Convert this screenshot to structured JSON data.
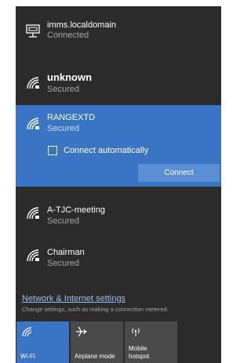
{
  "networks": [
    {
      "name": "imms.localdomain",
      "status": "Connected",
      "icon": "ethernet-icon"
    },
    {
      "name": "unknown",
      "status": "Secured",
      "icon": "wifi-secured-icon"
    },
    {
      "name": "RANGEXTD",
      "status": "Secured",
      "icon": "wifi-secured-icon"
    },
    {
      "name": "A-TJC-meeting",
      "status": "Secured",
      "icon": "wifi-secured-icon"
    },
    {
      "name": "Chairman",
      "status": "Secured",
      "icon": "wifi-secured-icon"
    }
  ],
  "selected": {
    "connect_auto_label": "Connect automatically",
    "connect_auto_checked": false,
    "connect_label": "Connect"
  },
  "settings": {
    "link_text": "Network & Internet settings",
    "description": "Change settings, such as making a connection metered."
  },
  "quick_actions": [
    {
      "label": "Wi-Fi",
      "icon": "wifi-icon",
      "active": true
    },
    {
      "label": "Airplane mode",
      "icon": "airplane-icon",
      "active": false
    },
    {
      "label": "Mobile\nhotspot",
      "icon": "hotspot-icon",
      "active": false
    }
  ],
  "colors": {
    "panel_bg": "#2b2b2b",
    "accent": "#3a74c4",
    "button": "#5b8fd3",
    "link": "#9dbfe9",
    "secondary_text": "#a6a6a6"
  }
}
